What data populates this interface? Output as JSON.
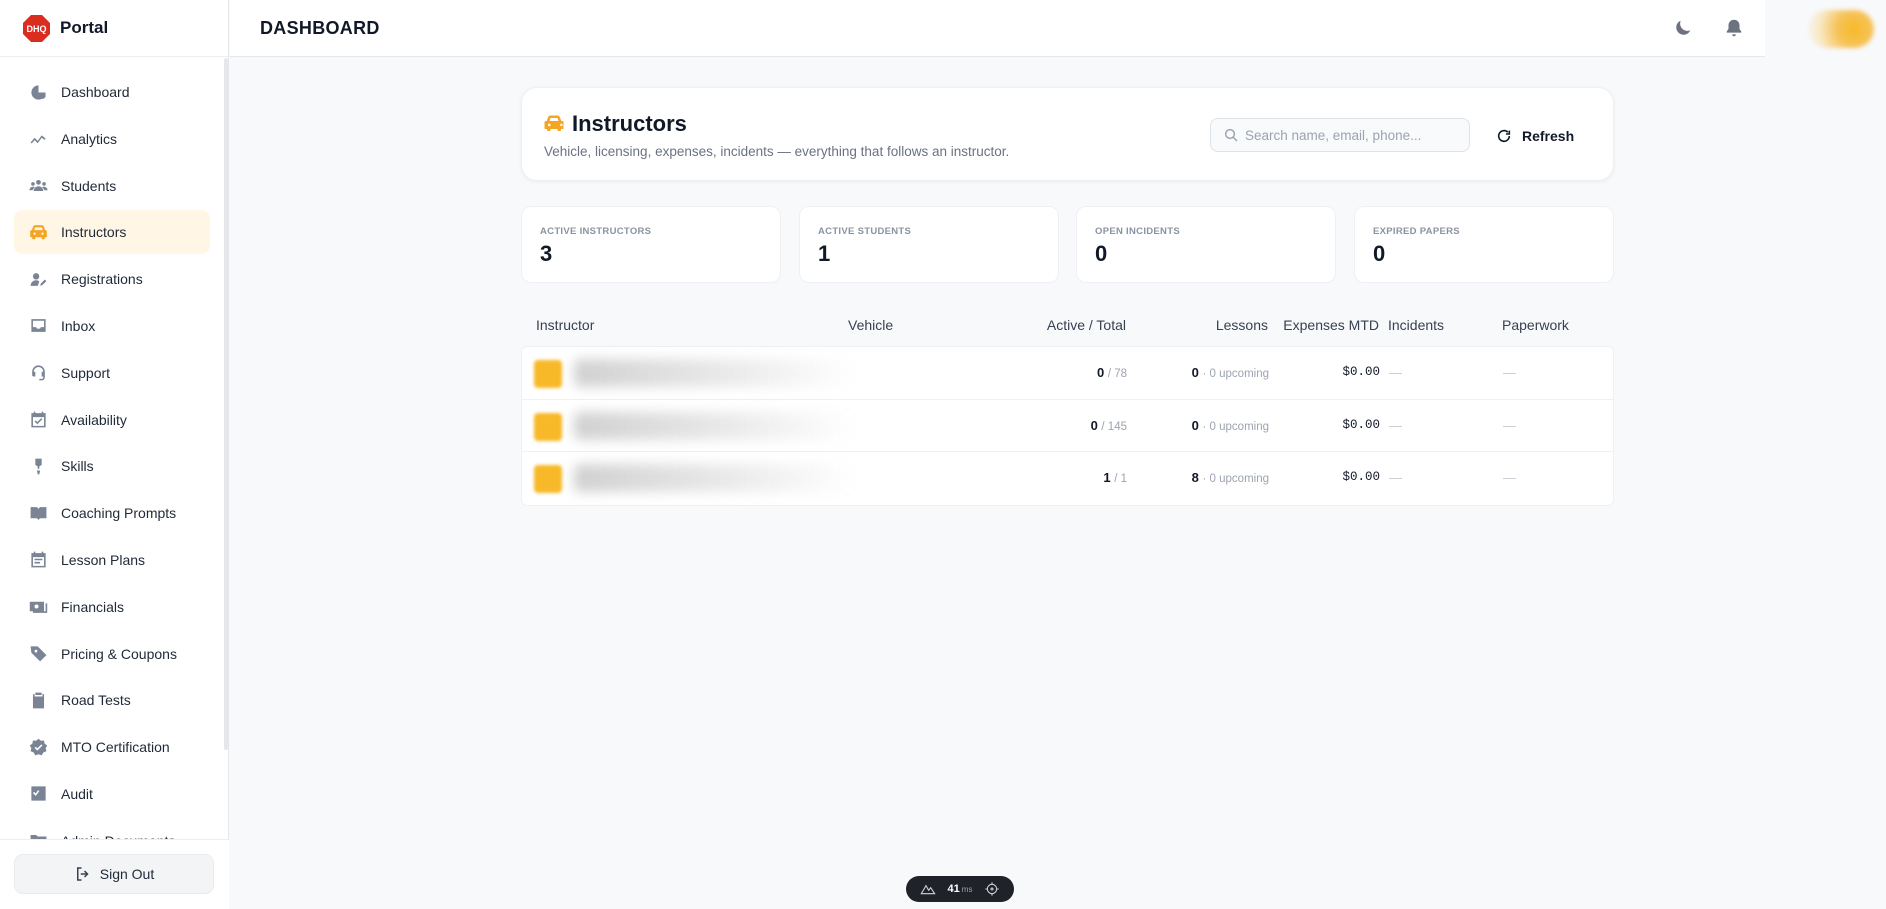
{
  "brand": {
    "logo_text": "DHQ",
    "title": "Portal"
  },
  "header": {
    "title": "DASHBOARD"
  },
  "sidebar": {
    "items": [
      {
        "label": "Dashboard",
        "icon": "dashboard-icon",
        "active": false
      },
      {
        "label": "Analytics",
        "icon": "analytics-icon",
        "active": false
      },
      {
        "label": "Students",
        "icon": "students-icon",
        "active": false
      },
      {
        "label": "Instructors",
        "icon": "car-icon",
        "active": true
      },
      {
        "label": "Registrations",
        "icon": "registrations-icon",
        "active": false
      },
      {
        "label": "Inbox",
        "icon": "inbox-icon",
        "active": false
      },
      {
        "label": "Support",
        "icon": "support-icon",
        "active": false
      },
      {
        "label": "Availability",
        "icon": "calendar-check-icon",
        "active": false
      },
      {
        "label": "Skills",
        "icon": "skills-icon",
        "active": false
      },
      {
        "label": "Coaching Prompts",
        "icon": "book-icon",
        "active": false
      },
      {
        "label": "Lesson Plans",
        "icon": "calendar-icon",
        "active": false
      },
      {
        "label": "Financials",
        "icon": "money-icon",
        "active": false
      },
      {
        "label": "Pricing & Coupons",
        "icon": "tag-icon",
        "active": false
      },
      {
        "label": "Road Tests",
        "icon": "clipboard-check-icon",
        "active": false
      },
      {
        "label": "MTO Certification",
        "icon": "badge-check-icon",
        "active": false
      },
      {
        "label": "Audit",
        "icon": "audit-icon",
        "active": false
      },
      {
        "label": "Admin Documents",
        "icon": "folder-icon",
        "active": false
      }
    ],
    "signout_label": "Sign Out"
  },
  "hero": {
    "title": "Instructors",
    "subtitle": "Vehicle, licensing, expenses, incidents — everything that follows an instructor.",
    "search_placeholder": "Search name, email, phone...",
    "refresh_label": "Refresh"
  },
  "stats": [
    {
      "label": "ACTIVE INSTRUCTORS",
      "value": "3"
    },
    {
      "label": "ACTIVE STUDENTS",
      "value": "1"
    },
    {
      "label": "OPEN INCIDENTS",
      "value": "0"
    },
    {
      "label": "EXPIRED PAPERS",
      "value": "0"
    }
  ],
  "table": {
    "columns": [
      "Instructor",
      "Vehicle",
      "Active / Total",
      "Lessons",
      "Expenses MTD",
      "Incidents",
      "Paperwork"
    ],
    "rows": [
      {
        "active": "0",
        "total": "/ 78",
        "lessons": "0",
        "upcoming": "· 0 upcoming",
        "expenses": "$0.00",
        "incidents": "—",
        "paperwork": "—"
      },
      {
        "active": "0",
        "total": "/ 145",
        "lessons": "0",
        "upcoming": "· 0 upcoming",
        "expenses": "$0.00",
        "incidents": "—",
        "paperwork": "—"
      },
      {
        "active": "1",
        "total": "/ 1",
        "lessons": "8",
        "upcoming": "· 0 upcoming",
        "expenses": "$0.00",
        "incidents": "—",
        "paperwork": "—"
      }
    ]
  },
  "perf": {
    "value": "41",
    "unit": "ms"
  },
  "colors": {
    "accent": "#f5a524",
    "active_bg": "#fff6e6",
    "logo_red": "#d92d20"
  }
}
